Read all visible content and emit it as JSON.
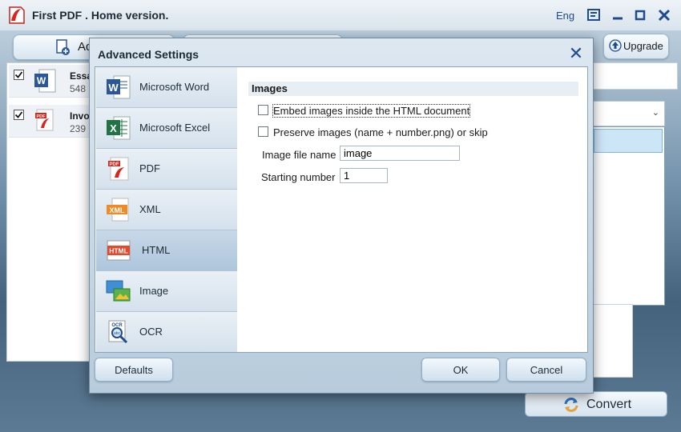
{
  "app": {
    "title": "First PDF . Home version.",
    "language": "Eng"
  },
  "toolbar": {
    "add_label": "Ad",
    "upgrade_label": "Upgrade"
  },
  "files": [
    {
      "name": "Essa",
      "size": "548",
      "type": "word"
    },
    {
      "name": "Invo",
      "size": "239",
      "type": "pdf"
    }
  ],
  "convert_label": "Convert",
  "dialog": {
    "title": "Advanced Settings",
    "sidebar": [
      {
        "label": "Microsoft Word",
        "icon": "word-icon"
      },
      {
        "label": "Microsoft Excel",
        "icon": "excel-icon"
      },
      {
        "label": "PDF",
        "icon": "pdf-icon"
      },
      {
        "label": "XML",
        "icon": "xml-icon"
      },
      {
        "label": "HTML",
        "icon": "html-icon",
        "active": true
      },
      {
        "label": "Image",
        "icon": "image-icon"
      },
      {
        "label": "OCR",
        "icon": "ocr-icon"
      }
    ],
    "section_title": "Images",
    "options": [
      {
        "label": "Embed images inside the HTML document",
        "checked": false
      },
      {
        "label": "Preserve images (name + number.png) or skip",
        "checked": false
      }
    ],
    "image_file_name_label": "Image file name",
    "image_file_name_value": "image",
    "starting_number_label": "Starting number",
    "starting_number_value": "1",
    "buttons": {
      "defaults": "Defaults",
      "ok": "OK",
      "cancel": "Cancel"
    }
  },
  "colors": {
    "accent": "#1e4b8f",
    "word": "#2b5797",
    "excel": "#217346",
    "pdf": "#d9251c"
  }
}
